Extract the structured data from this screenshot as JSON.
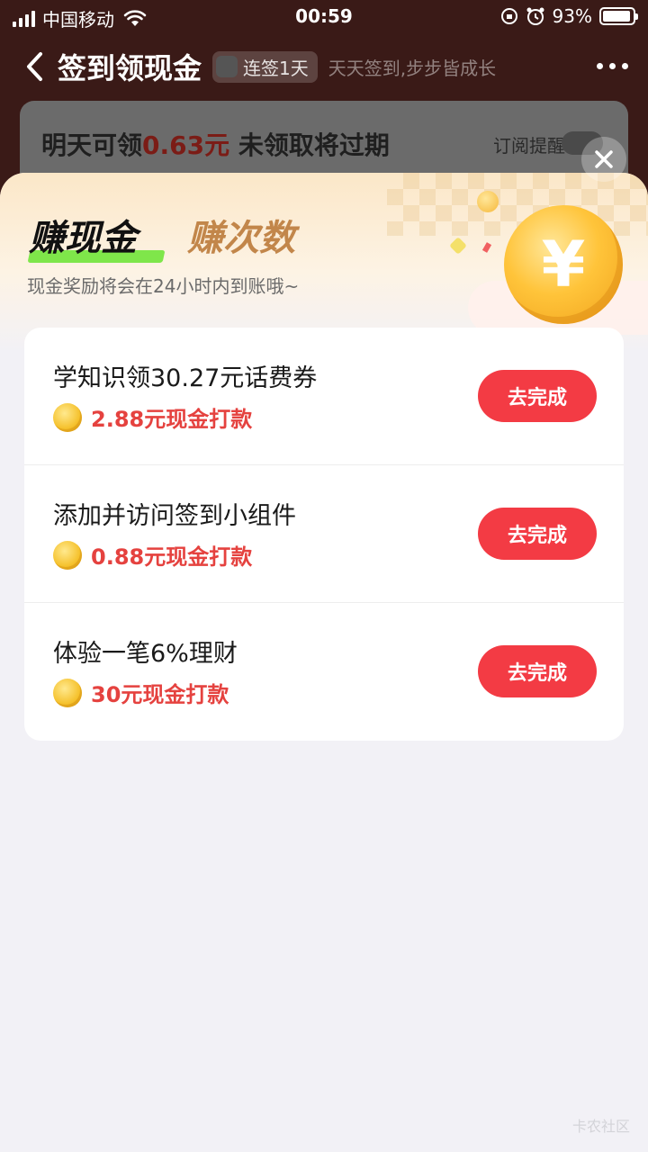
{
  "status_bar": {
    "carrier": "中国移动",
    "time": "00:59",
    "battery": "93%",
    "battery_level": 0.93
  },
  "nav": {
    "title": "签到领现金",
    "streak_badge": "连签1天",
    "slogan": "天天签到,步步皆成长"
  },
  "background_card": {
    "title_prefix": "明天可领",
    "amount": "0.63元",
    "title_suffix": " 未领取将过期",
    "remind_label": "订阅提醒"
  },
  "sheet": {
    "tab_active": "赚现金",
    "tab_inactive": "赚次数",
    "subtitle": "现金奖励将会在24小时内到账哦~",
    "coin_symbol": "¥",
    "tasks": [
      {
        "title": "学知识领30.27元话费券",
        "reward": "2.88元现金打款",
        "button": "去完成"
      },
      {
        "title": "添加并访问签到小组件",
        "reward": "0.88元现金打款",
        "button": "去完成"
      },
      {
        "title": "体验一笔6%理财",
        "reward": "30元现金打款",
        "button": "去完成"
      }
    ]
  },
  "watermark": "卡农社区",
  "colors": {
    "accent_red": "#f33b44",
    "reward_red": "#e5423f",
    "tab_highlight": "#7fe64a",
    "tab_inactive": "#c2864a"
  }
}
